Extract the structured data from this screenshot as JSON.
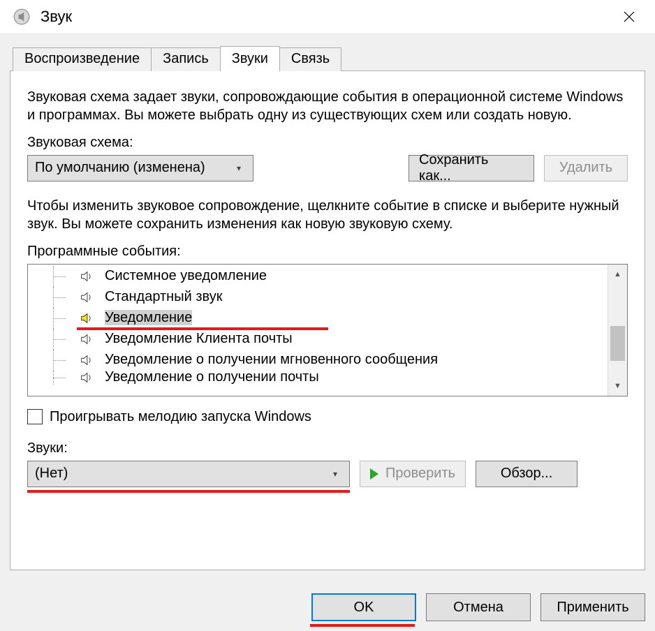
{
  "window": {
    "title": "Звук"
  },
  "tabs": {
    "playback": "Воспроизведение",
    "recording": "Запись",
    "sounds": "Звуки",
    "comm": "Связь"
  },
  "page": {
    "intro": "Звуковая схема задает звуки, сопровождающие события в операционной системе Windows и программах. Вы можете выбрать одну из существующих схем или создать новую.",
    "scheme_label": "Звуковая схема:",
    "scheme_value": "По умолчанию (изменена)",
    "save_as": "Сохранить как...",
    "delete": "Удалить",
    "events_help": "Чтобы изменить звуковое сопровождение, щелкните событие в списке и выберите нужный звук. Вы можете сохранить изменения как новую звуковую схему.",
    "events_label": "Программные события:",
    "events": {
      "e0": "Системное уведомление",
      "e1": "Стандартный звук",
      "e2": "Уведомление",
      "e3": "Уведомление Клиента почты",
      "e4": "Уведомление о получении мгновенного сообщения",
      "e5": "Уведомление о получении почты"
    },
    "startup_checkbox": "Проигрывать мелодию запуска Windows",
    "sounds_label": "Звуки:",
    "sound_value": "(Нет)",
    "test": "Проверить",
    "browse": "Обзор..."
  },
  "footer": {
    "ok": "OK",
    "cancel": "Отмена",
    "apply": "Применить"
  }
}
